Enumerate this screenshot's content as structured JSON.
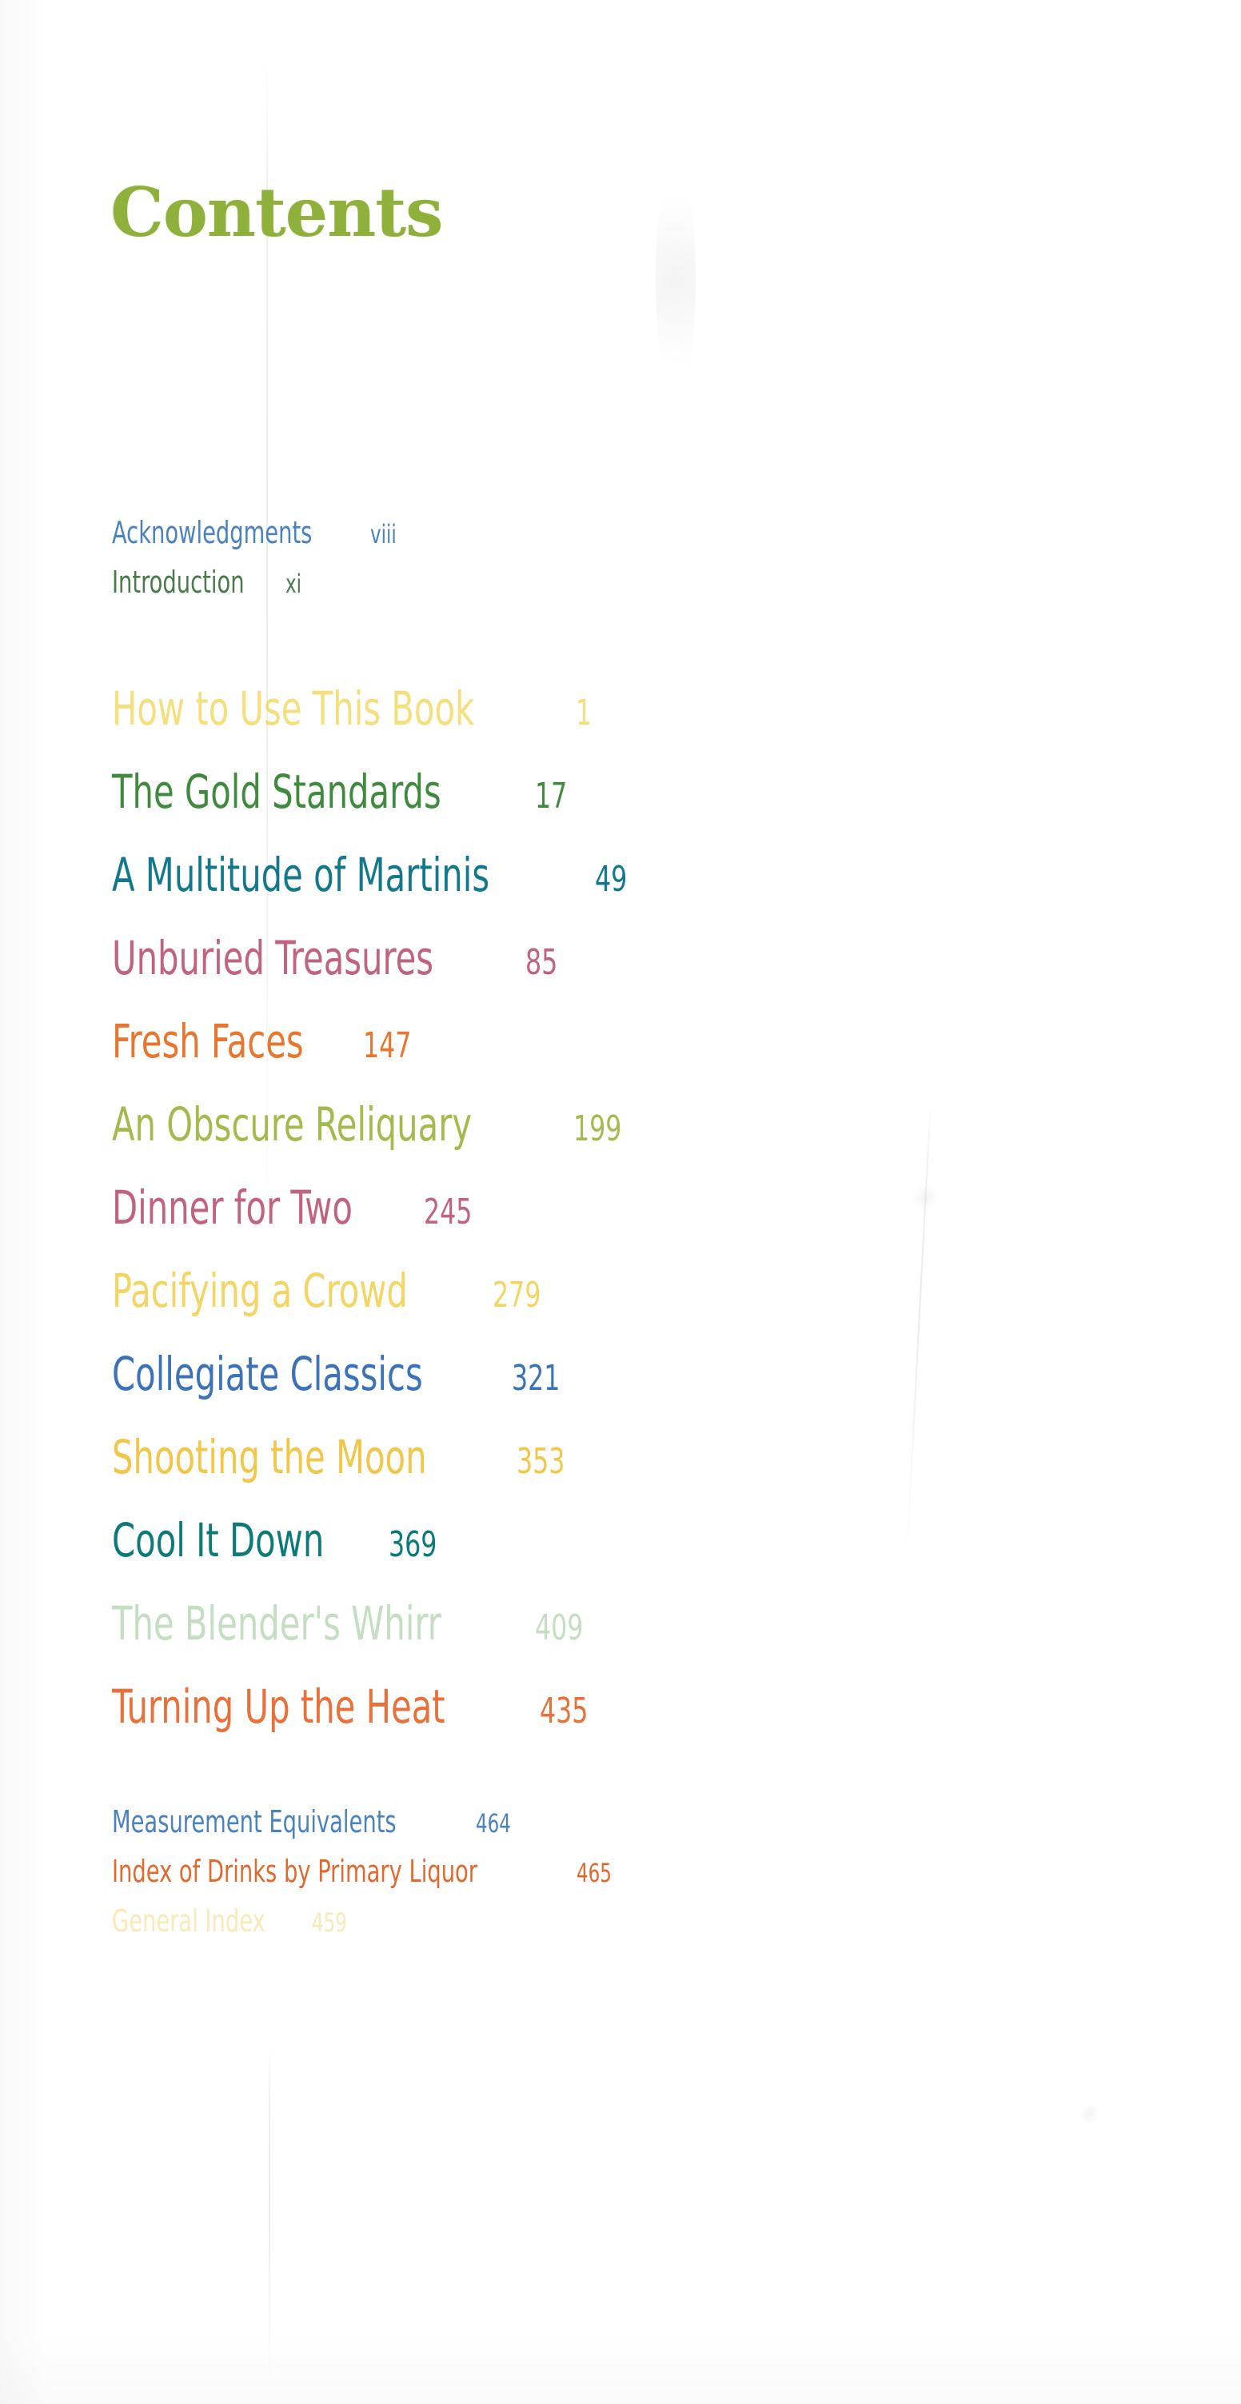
{
  "page": {
    "title": "Contents",
    "title_color": "#8fb13c",
    "background": "#ffffff"
  },
  "front_matter": [
    {
      "label": "Acknowledgments",
      "page": "viii",
      "color": "#4a82bd",
      "opacity": 1.0
    },
    {
      "label": "Introduction",
      "page": "xi",
      "color": "#4b7a4a",
      "opacity": 1.0
    }
  ],
  "chapters": [
    {
      "label": "How to Use This Book",
      "page": "1",
      "color": "#f2d24a",
      "opacity": 0.72
    },
    {
      "label": "The Gold Standards",
      "page": "17",
      "color": "#3f8a3f",
      "opacity": 1.0
    },
    {
      "label": "A Multitude of Martinis",
      "page": "49",
      "color": "#14788c",
      "opacity": 1.0
    },
    {
      "label": "Unburied Treasures",
      "page": "85",
      "color": "#c0637e",
      "opacity": 1.0
    },
    {
      "label": "Fresh Faces",
      "page": "147",
      "color": "#e8762e",
      "opacity": 1.0
    },
    {
      "label": "An Obscure Reliquary",
      "page": "199",
      "color": "#9cb63f",
      "opacity": 0.92
    },
    {
      "label": "Dinner for Two",
      "page": "245",
      "color": "#c0637e",
      "opacity": 1.0
    },
    {
      "label": "Pacifying a Crowd",
      "page": "279",
      "color": "#f2cb3e",
      "opacity": 0.8
    },
    {
      "label": "Collegiate Classics",
      "page": "321",
      "color": "#3b72b8",
      "opacity": 1.0
    },
    {
      "label": "Shooting the Moon",
      "page": "353",
      "color": "#f0c23a",
      "opacity": 0.92
    },
    {
      "label": "Cool It Down",
      "page": "369",
      "color": "#0d7a7a",
      "opacity": 1.0
    },
    {
      "label": "The Blender's Whirr",
      "page": "409",
      "color": "#93c48f",
      "opacity": 0.55
    },
    {
      "label": "Turning Up the Heat",
      "page": "435",
      "color": "#e8703a",
      "opacity": 1.0
    }
  ],
  "back_matter": [
    {
      "label": "Measurement Equivalents",
      "page": "464",
      "color": "#4a82bd",
      "opacity": 1.0
    },
    {
      "label": "Index of Drinks by Primary Liquor",
      "page": "465",
      "color": "#e06a2e",
      "opacity": 1.0
    },
    {
      "label": "General Index",
      "page": "459",
      "color": "#f0d060",
      "opacity": 0.45
    }
  ]
}
